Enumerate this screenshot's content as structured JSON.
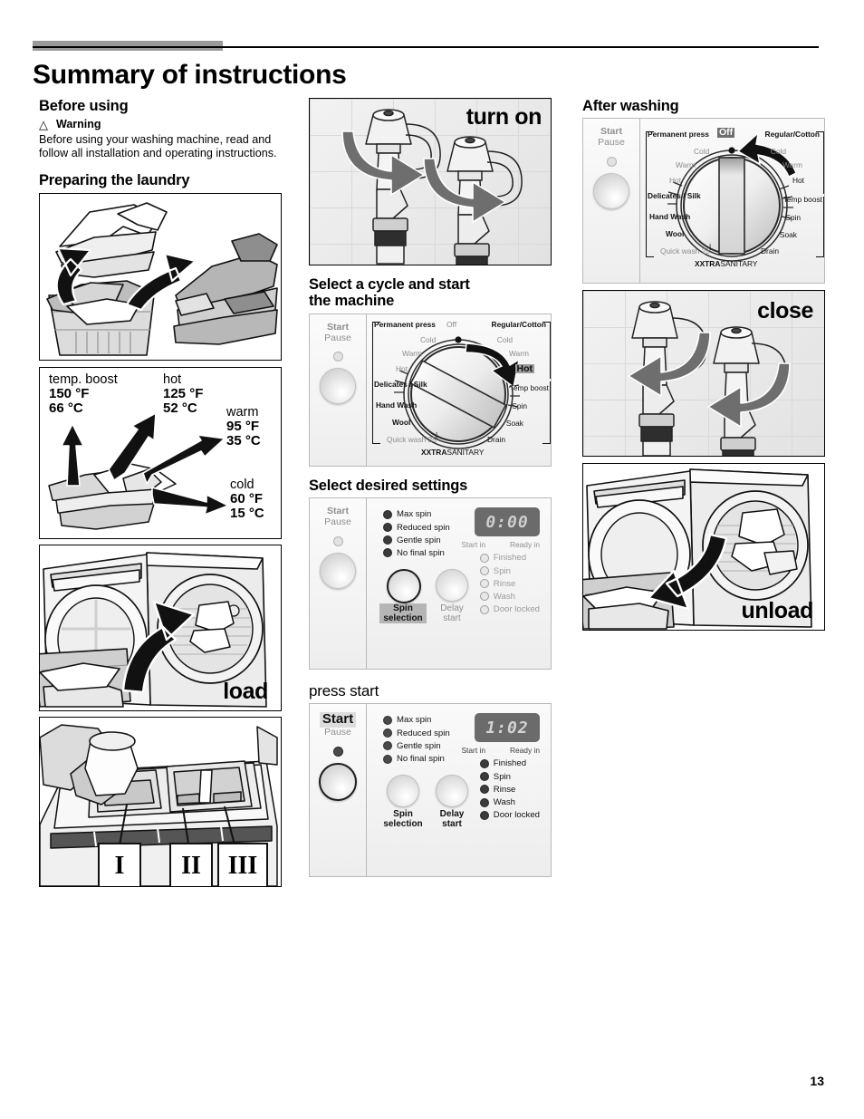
{
  "page": {
    "title": "Summary of instructions",
    "number": "13"
  },
  "left_column": {
    "before_using": {
      "heading": "Before using",
      "warning_icon": "warning-triangle-icon",
      "warning_label": "Warning",
      "warning_text": "Before using your washing machine, read and follow all installation and operating instructions."
    },
    "preparing": {
      "heading": "Preparing the laundry",
      "figure_alt": "sort-laundry-illustration"
    },
    "temperature_figure": {
      "alt": "wash-temperature-chart",
      "entries": [
        {
          "name": "temp. boost",
          "f": "150 °F",
          "c": "66 °C"
        },
        {
          "name": "hot",
          "f": "125 °F",
          "c": "52 °C"
        },
        {
          "name": "warm",
          "f": "95 °F",
          "c": "35 °C"
        },
        {
          "name": "cold",
          "f": "60 °F",
          "c": "15 °C"
        }
      ]
    },
    "load_figure": {
      "caption": "load",
      "alt": "load-washer-illustration"
    },
    "detergent_figure": {
      "alt": "detergent-dispenser-illustration",
      "compartments": [
        "I",
        "II",
        "III"
      ]
    }
  },
  "middle_column": {
    "turn_on_figure": {
      "caption": "turn on",
      "alt": "open-water-taps-illustration"
    },
    "select_cycle": {
      "heading_line1": "Select a cycle and start",
      "heading_line2": "the machine"
    },
    "cycle_panel": {
      "start_label": "Start",
      "pause_label": "Pause",
      "dial": {
        "off": "Off",
        "left_group": "Permanent press",
        "right_group": "Regular/Cotton",
        "left_temps": [
          "Cold",
          "Warm",
          "Hot"
        ],
        "right_temps": [
          "Cold",
          "Warm",
          "Hot",
          "Temp boost"
        ],
        "selected_temp": "Hot",
        "programs": [
          "Delicates / Silk",
          "Hand Wash",
          "Wool",
          "Quick wash 25"
        ],
        "functions": [
          "Spin",
          "Soak",
          "Drain"
        ],
        "bottom_label_bold": "XXTRA",
        "bottom_label_rest": "SANITARY"
      }
    },
    "select_settings": {
      "heading": "Select desired settings",
      "start_label": "Start",
      "pause_label": "Pause",
      "spin_options": [
        "Max spin",
        "Reduced spin",
        "Gentle spin",
        "No final spin"
      ],
      "display": "0:00",
      "display_labels": [
        "Start in",
        "Ready in"
      ],
      "status_options": [
        "Finished",
        "Spin",
        "Rinse",
        "Wash",
        "Door locked"
      ],
      "spin_button": {
        "line1": "Spin",
        "line2": "selection"
      },
      "delay_button": {
        "line1": "Delay",
        "line2": "start"
      }
    },
    "press_start": {
      "heading": "press start",
      "start_label": "Start",
      "pause_label": "Pause",
      "spin_options": [
        "Max spin",
        "Reduced spin",
        "Gentle spin",
        "No final spin"
      ],
      "display": "1:02",
      "display_labels": [
        "Start in",
        "Ready in"
      ],
      "status_options": [
        "Finished",
        "Spin",
        "Rinse",
        "Wash",
        "Door locked"
      ],
      "spin_button": {
        "line1": "Spin",
        "line2": "selection"
      },
      "delay_button": {
        "line1": "Delay",
        "line2": "start"
      }
    }
  },
  "right_column": {
    "after_washing": {
      "heading": "After washing"
    },
    "off_panel": {
      "start_label": "Start",
      "pause_label": "Pause",
      "dial": {
        "off": "Off",
        "left_group": "Permanent press",
        "right_group": "Regular/Cotton",
        "left_temps": [
          "Cold",
          "Warm",
          "Hot"
        ],
        "right_temps": [
          "Cold",
          "Warm",
          "Hot",
          "Temp boost"
        ],
        "programs": [
          "Delicates / Silk",
          "Hand Wash",
          "Wool",
          "Quick wash 25"
        ],
        "functions": [
          "Spin",
          "Soak",
          "Drain"
        ],
        "bottom_label_bold": "XXTRA",
        "bottom_label_rest": "SANITARY"
      }
    },
    "close_figure": {
      "caption": "close",
      "alt": "close-water-taps-illustration"
    },
    "unload_figure": {
      "caption": "unload",
      "alt": "unload-washer-illustration"
    }
  },
  "colors": {
    "header_block": "#9a9a9a",
    "arrow_black": "#111111",
    "arrow_gray": "#6e6e6e",
    "lcd_bg": "#6b6b6b"
  }
}
